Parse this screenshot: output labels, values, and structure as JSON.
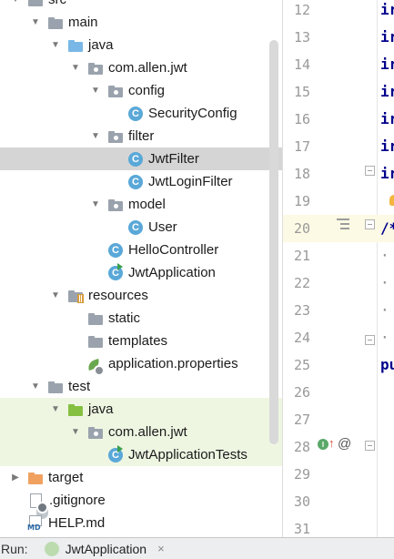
{
  "tree": {
    "rows": [
      {
        "label": "src",
        "arrow": "down",
        "icon": "folder-gray",
        "depth": 1
      },
      {
        "label": "main",
        "arrow": "down",
        "icon": "folder-gray",
        "depth": 2
      },
      {
        "label": "java",
        "arrow": "down",
        "icon": "folder-blue",
        "depth": 3
      },
      {
        "label": "com.allen.jwt",
        "arrow": "down",
        "icon": "package",
        "depth": 4
      },
      {
        "label": "config",
        "arrow": "down",
        "icon": "package",
        "depth": 5
      },
      {
        "label": "SecurityConfig",
        "arrow": "",
        "icon": "class",
        "depth": 6
      },
      {
        "label": "filter",
        "arrow": "down",
        "icon": "package",
        "depth": 5
      },
      {
        "label": "JwtFilter",
        "arrow": "",
        "icon": "class",
        "depth": 6,
        "selected": true
      },
      {
        "label": "JwtLoginFilter",
        "arrow": "",
        "icon": "class",
        "depth": 6
      },
      {
        "label": "model",
        "arrow": "down",
        "icon": "package",
        "depth": 5
      },
      {
        "label": "User",
        "arrow": "",
        "icon": "class",
        "depth": 6
      },
      {
        "label": "HelloController",
        "arrow": "",
        "icon": "class",
        "depth": 5
      },
      {
        "label": "JwtApplication",
        "arrow": "",
        "icon": "class-run",
        "depth": 5
      },
      {
        "label": "resources",
        "arrow": "down",
        "icon": "folder-resources",
        "depth": 3
      },
      {
        "label": "static",
        "arrow": "",
        "icon": "folder-gray",
        "depth": 4
      },
      {
        "label": "templates",
        "arrow": "",
        "icon": "folder-gray",
        "depth": 4
      },
      {
        "label": "application.properties",
        "arrow": "",
        "icon": "properties",
        "depth": 4
      },
      {
        "label": "test",
        "arrow": "down",
        "icon": "folder-gray",
        "depth": 2
      },
      {
        "label": "java",
        "arrow": "down",
        "icon": "folder-green",
        "depth": 3,
        "test": true
      },
      {
        "label": "com.allen.jwt",
        "arrow": "down",
        "icon": "package",
        "depth": 4,
        "test": true
      },
      {
        "label": "JwtApplicationTests",
        "arrow": "",
        "icon": "class-run",
        "depth": 5,
        "test": true
      },
      {
        "label": "target",
        "arrow": "right",
        "icon": "folder-orange",
        "depth": 1
      },
      {
        "label": ".gitignore",
        "arrow": "",
        "icon": "gitignore",
        "depth": 1
      },
      {
        "label": "HELP.md",
        "arrow": "",
        "icon": "markdown",
        "depth": 1
      }
    ]
  },
  "editor": {
    "lines": [
      {
        "num": "12",
        "code": "ir"
      },
      {
        "num": "13",
        "code": "ir"
      },
      {
        "num": "14",
        "code": "ir"
      },
      {
        "num": "15",
        "code": "ir"
      },
      {
        "num": "16",
        "code": "ir"
      },
      {
        "num": "17",
        "code": "ir"
      },
      {
        "num": "18",
        "code": "ir"
      },
      {
        "num": "19",
        "code": ""
      },
      {
        "num": "20",
        "code": "/*",
        "current": true
      },
      {
        "num": "21",
        "code": "·"
      },
      {
        "num": "22",
        "code": "·"
      },
      {
        "num": "23",
        "code": "·"
      },
      {
        "num": "24",
        "code": "·"
      },
      {
        "num": "25",
        "code": "pu"
      },
      {
        "num": "26",
        "code": ""
      },
      {
        "num": "27",
        "code": ""
      },
      {
        "num": "28",
        "code": ""
      },
      {
        "num": "29",
        "code": ""
      },
      {
        "num": "30",
        "code": ""
      },
      {
        "num": "31",
        "code": ""
      }
    ],
    "gutter_icons": {
      "implemented_marker": "I",
      "override_arrow": "↑",
      "annotation": "@"
    }
  },
  "bottom_bar": {
    "run_label": "Run:",
    "run_tab": "JwtApplication",
    "close_glyph": "×"
  }
}
